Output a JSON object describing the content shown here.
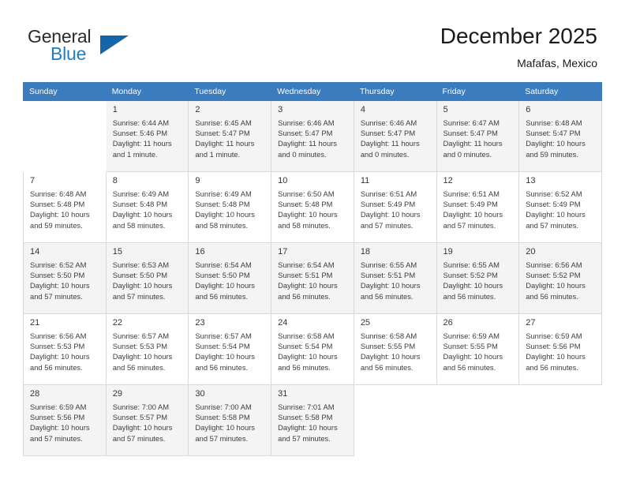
{
  "logo": {
    "word_one": "General",
    "word_two": "Blue",
    "triangle_icon": "triangle-icon"
  },
  "header": {
    "title": "December 2025",
    "subtitle": "Mafafas, Mexico"
  },
  "colors": {
    "header_blue": "#3a7cbe",
    "logo_blue": "#1d7ec6",
    "logo_triangle": "#1565a8",
    "alt_row": "#f4f4f4",
    "grid_border": "#d9d9d9"
  },
  "weekdays": [
    "Sunday",
    "Monday",
    "Tuesday",
    "Wednesday",
    "Thursday",
    "Friday",
    "Saturday"
  ],
  "weeks": [
    [
      {
        "day": "",
        "sunrise": "",
        "sunset": "",
        "daylight": "",
        "empty": true
      },
      {
        "day": "1",
        "sunrise": "Sunrise: 6:44 AM",
        "sunset": "Sunset: 5:46 PM",
        "daylight": "Daylight: 11 hours and 1 minute."
      },
      {
        "day": "2",
        "sunrise": "Sunrise: 6:45 AM",
        "sunset": "Sunset: 5:47 PM",
        "daylight": "Daylight: 11 hours and 1 minute."
      },
      {
        "day": "3",
        "sunrise": "Sunrise: 6:46 AM",
        "sunset": "Sunset: 5:47 PM",
        "daylight": "Daylight: 11 hours and 0 minutes."
      },
      {
        "day": "4",
        "sunrise": "Sunrise: 6:46 AM",
        "sunset": "Sunset: 5:47 PM",
        "daylight": "Daylight: 11 hours and 0 minutes."
      },
      {
        "day": "5",
        "sunrise": "Sunrise: 6:47 AM",
        "sunset": "Sunset: 5:47 PM",
        "daylight": "Daylight: 11 hours and 0 minutes."
      },
      {
        "day": "6",
        "sunrise": "Sunrise: 6:48 AM",
        "sunset": "Sunset: 5:47 PM",
        "daylight": "Daylight: 10 hours and 59 minutes."
      }
    ],
    [
      {
        "day": "7",
        "sunrise": "Sunrise: 6:48 AM",
        "sunset": "Sunset: 5:48 PM",
        "daylight": "Daylight: 10 hours and 59 minutes."
      },
      {
        "day": "8",
        "sunrise": "Sunrise: 6:49 AM",
        "sunset": "Sunset: 5:48 PM",
        "daylight": "Daylight: 10 hours and 58 minutes."
      },
      {
        "day": "9",
        "sunrise": "Sunrise: 6:49 AM",
        "sunset": "Sunset: 5:48 PM",
        "daylight": "Daylight: 10 hours and 58 minutes."
      },
      {
        "day": "10",
        "sunrise": "Sunrise: 6:50 AM",
        "sunset": "Sunset: 5:48 PM",
        "daylight": "Daylight: 10 hours and 58 minutes."
      },
      {
        "day": "11",
        "sunrise": "Sunrise: 6:51 AM",
        "sunset": "Sunset: 5:49 PM",
        "daylight": "Daylight: 10 hours and 57 minutes."
      },
      {
        "day": "12",
        "sunrise": "Sunrise: 6:51 AM",
        "sunset": "Sunset: 5:49 PM",
        "daylight": "Daylight: 10 hours and 57 minutes."
      },
      {
        "day": "13",
        "sunrise": "Sunrise: 6:52 AM",
        "sunset": "Sunset: 5:49 PM",
        "daylight": "Daylight: 10 hours and 57 minutes."
      }
    ],
    [
      {
        "day": "14",
        "sunrise": "Sunrise: 6:52 AM",
        "sunset": "Sunset: 5:50 PM",
        "daylight": "Daylight: 10 hours and 57 minutes."
      },
      {
        "day": "15",
        "sunrise": "Sunrise: 6:53 AM",
        "sunset": "Sunset: 5:50 PM",
        "daylight": "Daylight: 10 hours and 57 minutes."
      },
      {
        "day": "16",
        "sunrise": "Sunrise: 6:54 AM",
        "sunset": "Sunset: 5:50 PM",
        "daylight": "Daylight: 10 hours and 56 minutes."
      },
      {
        "day": "17",
        "sunrise": "Sunrise: 6:54 AM",
        "sunset": "Sunset: 5:51 PM",
        "daylight": "Daylight: 10 hours and 56 minutes."
      },
      {
        "day": "18",
        "sunrise": "Sunrise: 6:55 AM",
        "sunset": "Sunset: 5:51 PM",
        "daylight": "Daylight: 10 hours and 56 minutes."
      },
      {
        "day": "19",
        "sunrise": "Sunrise: 6:55 AM",
        "sunset": "Sunset: 5:52 PM",
        "daylight": "Daylight: 10 hours and 56 minutes."
      },
      {
        "day": "20",
        "sunrise": "Sunrise: 6:56 AM",
        "sunset": "Sunset: 5:52 PM",
        "daylight": "Daylight: 10 hours and 56 minutes."
      }
    ],
    [
      {
        "day": "21",
        "sunrise": "Sunrise: 6:56 AM",
        "sunset": "Sunset: 5:53 PM",
        "daylight": "Daylight: 10 hours and 56 minutes."
      },
      {
        "day": "22",
        "sunrise": "Sunrise: 6:57 AM",
        "sunset": "Sunset: 5:53 PM",
        "daylight": "Daylight: 10 hours and 56 minutes."
      },
      {
        "day": "23",
        "sunrise": "Sunrise: 6:57 AM",
        "sunset": "Sunset: 5:54 PM",
        "daylight": "Daylight: 10 hours and 56 minutes."
      },
      {
        "day": "24",
        "sunrise": "Sunrise: 6:58 AM",
        "sunset": "Sunset: 5:54 PM",
        "daylight": "Daylight: 10 hours and 56 minutes."
      },
      {
        "day": "25",
        "sunrise": "Sunrise: 6:58 AM",
        "sunset": "Sunset: 5:55 PM",
        "daylight": "Daylight: 10 hours and 56 minutes."
      },
      {
        "day": "26",
        "sunrise": "Sunrise: 6:59 AM",
        "sunset": "Sunset: 5:55 PM",
        "daylight": "Daylight: 10 hours and 56 minutes."
      },
      {
        "day": "27",
        "sunrise": "Sunrise: 6:59 AM",
        "sunset": "Sunset: 5:56 PM",
        "daylight": "Daylight: 10 hours and 56 minutes."
      }
    ],
    [
      {
        "day": "28",
        "sunrise": "Sunrise: 6:59 AM",
        "sunset": "Sunset: 5:56 PM",
        "daylight": "Daylight: 10 hours and 57 minutes."
      },
      {
        "day": "29",
        "sunrise": "Sunrise: 7:00 AM",
        "sunset": "Sunset: 5:57 PM",
        "daylight": "Daylight: 10 hours and 57 minutes."
      },
      {
        "day": "30",
        "sunrise": "Sunrise: 7:00 AM",
        "sunset": "Sunset: 5:58 PM",
        "daylight": "Daylight: 10 hours and 57 minutes."
      },
      {
        "day": "31",
        "sunrise": "Sunrise: 7:01 AM",
        "sunset": "Sunset: 5:58 PM",
        "daylight": "Daylight: 10 hours and 57 minutes."
      },
      {
        "day": "",
        "sunrise": "",
        "sunset": "",
        "daylight": "",
        "empty": true
      },
      {
        "day": "",
        "sunrise": "",
        "sunset": "",
        "daylight": "",
        "empty": true
      },
      {
        "day": "",
        "sunrise": "",
        "sunset": "",
        "daylight": "",
        "empty": true
      }
    ]
  ]
}
